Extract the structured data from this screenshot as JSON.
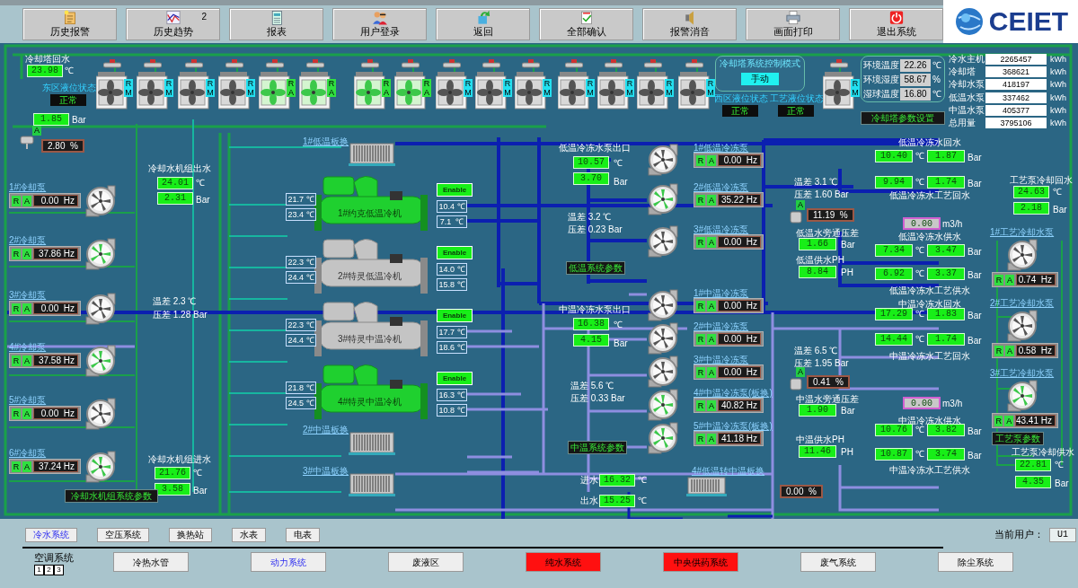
{
  "toolbar": [
    {
      "label": "历史报警"
    },
    {
      "label": "历史趋势",
      "badge": "2"
    },
    {
      "label": "报表"
    },
    {
      "label": "用户登录"
    },
    {
      "label": "返回"
    },
    {
      "label": "全部确认"
    },
    {
      "label": "报警消音"
    },
    {
      "label": "画面打印"
    },
    {
      "label": "退出系统"
    }
  ],
  "logo": "CEIET",
  "cooling_tower": {
    "return_water": {
      "label": "冷却塔回水",
      "temp": {
        "value": "23.98",
        "unit": "℃"
      },
      "pressure": {
        "value": "1.85",
        "unit": "Bar"
      }
    },
    "valve": {
      "tag": "A",
      "value": "2.80  %"
    },
    "level_status": [
      {
        "label": "东区液位状态",
        "value": "正常"
      },
      {
        "label": "西区液位状态",
        "value": "正常"
      },
      {
        "label": "工艺液位状态",
        "value": "正常"
      }
    ],
    "control_mode": {
      "title": "冷却塔系统控制模式",
      "value": "手动"
    },
    "fans": [
      {
        "status": "R",
        "mode": "M",
        "running": false
      },
      {
        "status": "R",
        "mode": "M",
        "running": false
      },
      {
        "status": "R",
        "mode": "M",
        "running": false
      },
      {
        "status": "R",
        "mode": "M",
        "running": false
      },
      {
        "status": "R",
        "mode": "A",
        "running": true
      },
      {
        "status": "R",
        "mode": "A",
        "running": true
      },
      {
        "status": "R",
        "mode": "A",
        "running": true
      },
      {
        "status": "R",
        "mode": "A",
        "running": true
      },
      {
        "status": "R",
        "mode": "M",
        "running": false
      },
      {
        "status": "R",
        "mode": "M",
        "running": false
      },
      {
        "status": "R",
        "mode": "M",
        "running": false
      },
      {
        "status": "R",
        "mode": "M",
        "running": false
      },
      {
        "status": "R",
        "mode": "M",
        "running": false
      },
      {
        "status": "R",
        "mode": "M",
        "running": false
      },
      {
        "status": "R",
        "mode": "M",
        "running": false
      },
      {
        "status": "R",
        "mode": "M",
        "running": false
      }
    ],
    "environment": [
      {
        "label": "环境温度",
        "value": "22.26",
        "unit": "℃"
      },
      {
        "label": "环境湿度",
        "value": "58.67",
        "unit": "%"
      },
      {
        "label": "湿球温度",
        "value": "16.80",
        "unit": "℃"
      }
    ],
    "settings_button": "冷却塔参数设置"
  },
  "energy": [
    {
      "label": "冷水主机",
      "value": "2265457",
      "unit": "kWh"
    },
    {
      "label": "冷却塔",
      "value": "368621",
      "unit": "kWh"
    },
    {
      "label": "冷却水泵",
      "value": "418197",
      "unit": "kWh"
    },
    {
      "label": "低温水泵",
      "value": "337462",
      "unit": "kWh"
    },
    {
      "label": "中温水泵",
      "value": "405377",
      "unit": "kWh"
    },
    {
      "label": "总用量",
      "value": "3795106",
      "unit": "kWh"
    }
  ],
  "cooling_pumps": {
    "items": [
      {
        "name": "1#冷却泵",
        "tags": [
          "R",
          "A"
        ],
        "value": "0.00  Hz",
        "running": false
      },
      {
        "name": "2#冷却泵",
        "tags": [
          "R",
          "A"
        ],
        "value": "37.86 Hz",
        "running": true
      },
      {
        "name": "3#冷却泵",
        "tags": [
          "R",
          "A"
        ],
        "value": "0.00  Hz",
        "running": false
      },
      {
        "name": "4#冷却泵",
        "tags": [
          "R",
          "A"
        ],
        "value": "37.58 Hz",
        "running": true
      },
      {
        "name": "5#冷却泵",
        "tags": [
          "R",
          "A"
        ],
        "value": "0.00  Hz",
        "running": false
      },
      {
        "name": "6#冷却泵",
        "tags": [
          "R",
          "A"
        ],
        "value": "37.24 Hz",
        "running": true
      }
    ],
    "outlet": {
      "label": "冷却水机组出水",
      "temp": {
        "value": "24.01",
        "unit": "℃"
      },
      "pressure": {
        "value": "2.31",
        "unit": "Bar"
      }
    },
    "inlet": {
      "label": "冷却水机组进水",
      "temp": {
        "value": "21.76",
        "unit": "℃"
      },
      "pressure": {
        "value": "3.58",
        "unit": "Bar"
      }
    },
    "temp_diff": "温差  2.3 ℃",
    "pressure_diff": "压差 1.28 Bar",
    "params_button": "冷却水机组系统参数"
  },
  "chillers": [
    {
      "name": "1#约克低温冷机",
      "running": true,
      "enable": "Enable",
      "cond_in": "21.7 ℃",
      "cond_out": "23.4 ℃",
      "evap_out": "10.4 ℃",
      "evap_in": "7.1  ℃"
    },
    {
      "name": "2#特灵低温冷机",
      "running": false,
      "enable": "Enable",
      "cond_in": "22.3 ℃",
      "cond_out": "24.4 ℃",
      "evap_out": "14.0 ℃",
      "evap_in": "15.8 ℃"
    },
    {
      "name": "3#特灵中温冷机",
      "running": false,
      "enable": "Enable",
      "cond_in": "22.3 ℃",
      "cond_out": "24.4 ℃",
      "evap_out": "17.7 ℃",
      "evap_in": "18.6 ℃"
    },
    {
      "name": "4#特灵中温冷机",
      "running": true,
      "enable": "Enable",
      "cond_in": "21.8 ℃",
      "cond_out": "24.5 ℃",
      "evap_out": "16.3 ℃",
      "evap_in": "10.8 ℃"
    }
  ],
  "plate_exchangers": [
    "1#低温板换",
    "2#中温板换",
    "3#中温板换",
    "4#低温转中温板换"
  ],
  "low_temp_pumps": {
    "header": "低温冷冻水泵出口",
    "temp": {
      "value": "10.57",
      "unit": "℃"
    },
    "pressure": {
      "value": "3.70",
      "unit": "Bar"
    },
    "temp_diff": "温差  3.2 ℃",
    "pressure_diff": "压差 0.23 Bar",
    "params_button": "低温系统参数",
    "items": [
      {
        "name": "1#低温冷冻泵",
        "tags": [
          "R",
          "A"
        ],
        "value": "0.00  Hz",
        "running": false
      },
      {
        "name": "2#低温冷冻泵",
        "tags": [
          "R",
          "A"
        ],
        "value": "35.22 Hz",
        "running": true
      },
      {
        "name": "3#低温冷冻泵",
        "tags": [
          "R",
          "A"
        ],
        "value": "0.00  Hz",
        "running": false
      }
    ]
  },
  "mid_temp_pumps": {
    "header": "中温冷冻水泵出口",
    "temp": {
      "value": "16.38",
      "unit": "℃"
    },
    "pressure": {
      "value": "4.15",
      "unit": "Bar"
    },
    "temp_diff": "温差  5.6 ℃",
    "pressure_diff": "压差 0.33 Bar",
    "params_button": "中温系统参数",
    "items": [
      {
        "name": "1#中温冷冻泵",
        "tags": [
          "R",
          "A"
        ],
        "value": "0.00  Hz",
        "running": false
      },
      {
        "name": "2#中温冷冻泵",
        "tags": [
          "R",
          "A"
        ],
        "value": "0.00  Hz",
        "running": false
      },
      {
        "name": "3#中温冷冻泵",
        "tags": [
          "R",
          "A"
        ],
        "value": "0.00  Hz",
        "running": false
      },
      {
        "name": "4#中温冷冻泵(板换)",
        "tags": [
          "R",
          "A"
        ],
        "value": "40.82 Hz",
        "running": true
      },
      {
        "name": "5#中温冷冻泵(板换)",
        "tags": [
          "R",
          "A"
        ],
        "value": "41.18 Hz",
        "running": true
      }
    ]
  },
  "transfer_exchanger": {
    "inlet": {
      "label": "进水",
      "value": "16.32",
      "unit": "℃"
    },
    "outlet": {
      "label": "出水",
      "value": "15.25",
      "unit": "℃"
    },
    "valve": "0.00  %"
  },
  "distribution": [
    {
      "temp_diff": "温差  3.1 ℃",
      "pressure_diff": "压差 1.60 Bar",
      "valve_tag": "A",
      "valve": "11.19  %",
      "bypass": {
        "label": "低温水旁通压差",
        "value": "1.66",
        "unit": "Bar"
      },
      "ph": {
        "label": "低温供水PH",
        "value": "8.84",
        "unit": "PH"
      },
      "flow": {
        "value": "0.00",
        "unit": "m3/h"
      },
      "lines": [
        {
          "label": "低温冷冻水回水",
          "temp": {
            "value": "10.40",
            "unit": "℃"
          },
          "pressure": {
            "value": "1.87",
            "unit": "Bar"
          }
        },
        {
          "label": "低温冷冻水工艺回水",
          "temp": {
            "value": "9.94",
            "unit": "℃"
          },
          "pressure": {
            "value": "1.74",
            "unit": "Bar"
          }
        },
        {
          "label": "低温冷冻水供水",
          "temp": {
            "value": "7.34",
            "unit": "℃"
          },
          "pressure": {
            "value": "3.47",
            "unit": "Bar"
          }
        },
        {
          "label": "低温冷冻水工艺供水",
          "temp": {
            "value": "6.92",
            "unit": "℃"
          },
          "pressure": {
            "value": "3.37",
            "unit": "Bar"
          }
        }
      ]
    },
    {
      "temp_diff": "温差  6.5 ℃",
      "pressure_diff": "压差 1.95 Bar",
      "valve_tag": "A",
      "valve": "0.41  %",
      "bypass": {
        "label": "中温水旁通压差",
        "value": "1.90",
        "unit": "Bar"
      },
      "ph": {
        "label": "中温供水PH",
        "value": "11.46",
        "unit": "PH"
      },
      "flow": {
        "value": "0.00",
        "unit": "m3/h"
      },
      "lines": [
        {
          "label": "中温冷冻水回水",
          "temp": {
            "value": "17.29",
            "unit": "℃"
          },
          "pressure": {
            "value": "1.83",
            "unit": "Bar"
          }
        },
        {
          "label": "中温冷冻水工艺回水",
          "temp": {
            "value": "14.44",
            "unit": "℃"
          },
          "pressure": {
            "value": "1.74",
            "unit": "Bar"
          }
        },
        {
          "label": "中温冷冻水供水",
          "temp": {
            "value": "10.76",
            "unit": "℃"
          },
          "pressure": {
            "value": "3.82",
            "unit": "Bar"
          }
        },
        {
          "label": "中温冷冻水工艺供水",
          "temp": {
            "value": "10.87",
            "unit": "℃"
          },
          "pressure": {
            "value": "3.74",
            "unit": "Bar"
          }
        }
      ]
    }
  ],
  "process_cooling": {
    "return": {
      "label": "工艺泵冷却回水",
      "temp": {
        "value": "24.63",
        "unit": "℃"
      },
      "pressure": {
        "value": "2.18",
        "unit": "Bar"
      }
    },
    "items": [
      {
        "name": "1#工艺冷却水泵",
        "tags": [
          "R",
          "A"
        ],
        "value": "0.74  Hz",
        "running": false
      },
      {
        "name": "2#工艺冷却水泵",
        "tags": [
          "R",
          "A"
        ],
        "value": "0.58  Hz",
        "running": false
      },
      {
        "name": "3#工艺冷却水泵",
        "tags": [
          "R",
          "A"
        ],
        "value": "43.41 Hz",
        "running": true
      }
    ],
    "params_button": "工艺泵参数",
    "supply": {
      "label": "工艺泵冷却供水",
      "temp": {
        "value": "22.81",
        "unit": "℃"
      },
      "pressure": {
        "value": "4.35",
        "unit": "Bar"
      }
    }
  },
  "system_tabs": [
    {
      "label": "冷水系统",
      "selected": true
    },
    {
      "label": "空压系统",
      "selected": false
    },
    {
      "label": "换热站",
      "selected": false
    },
    {
      "label": "水表",
      "selected": false
    },
    {
      "label": "电表",
      "selected": false
    }
  ],
  "current_user": {
    "label": "当前用户：",
    "value": "U1"
  },
  "area_group": {
    "label": "空调系统",
    "pages": [
      "1",
      "2",
      "3"
    ]
  },
  "subsystems": [
    {
      "label": "冷热水管",
      "selected": false,
      "alarm": false
    },
    {
      "label": "动力系统",
      "selected": true,
      "alarm": false
    },
    {
      "label": "废液区",
      "selected": false,
      "alarm": false
    },
    {
      "label": "纯水系统",
      "selected": false,
      "alarm": true
    },
    {
      "label": "中央供药系统",
      "selected": false,
      "alarm": true
    },
    {
      "label": "废气系统",
      "selected": false,
      "alarm": false
    },
    {
      "label": "除尘系统",
      "selected": false,
      "alarm": false
    }
  ]
}
